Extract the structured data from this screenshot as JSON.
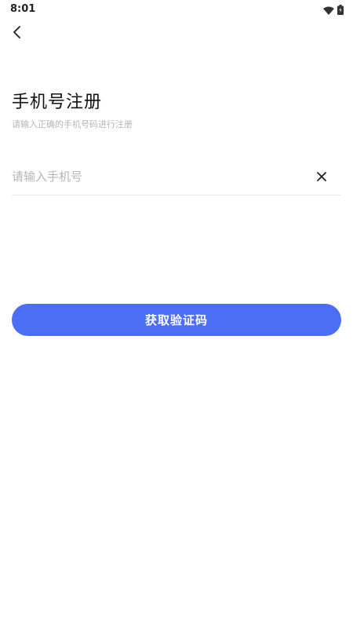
{
  "status_bar": {
    "time": "8:01",
    "icons": [
      "wifi-icon",
      "battery-icon"
    ]
  },
  "header": {
    "back_icon": "chevron-left-icon"
  },
  "main": {
    "title": "手机号注册",
    "subtitle": "请输入正确的手机号码进行注册",
    "phone_field": {
      "value": "",
      "placeholder": "请输入手机号",
      "clear_icon": "close-icon"
    },
    "submit_label": "获取验证码"
  },
  "colors": {
    "accent": "#4a6ff5",
    "placeholder": "#b5b5b5",
    "divider": "#e6e6e6"
  }
}
